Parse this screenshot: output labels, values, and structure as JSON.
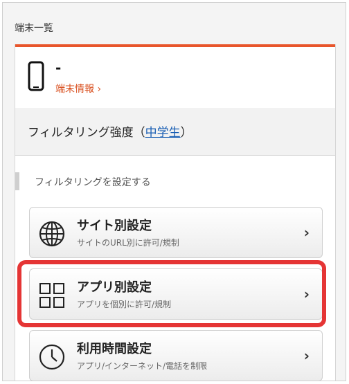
{
  "header": {
    "label": "端末一覧"
  },
  "device": {
    "name": "-",
    "info_link": "端末情報 ›"
  },
  "filter": {
    "strength_label": "フィルタリング強度（",
    "strength_value": "中学生",
    "strength_suffix": "）"
  },
  "section": {
    "title": "フィルタリングを設定する"
  },
  "menu": [
    {
      "icon": "globe-icon",
      "title": "サイト別設定",
      "subtitle": "サイトのURL別に許可/規制",
      "chevron": "›"
    },
    {
      "icon": "app-grid-icon",
      "title": "アプリ別設定",
      "subtitle": "アプリを個別に許可/規制",
      "chevron": "›"
    },
    {
      "icon": "clock-icon",
      "title": "利用時間設定",
      "subtitle": "アプリ/インターネット/電話を制限",
      "chevron": "›"
    }
  ],
  "colors": {
    "accent": "#e8552b",
    "link": "#1a5fb4",
    "highlight": "#e53535"
  }
}
